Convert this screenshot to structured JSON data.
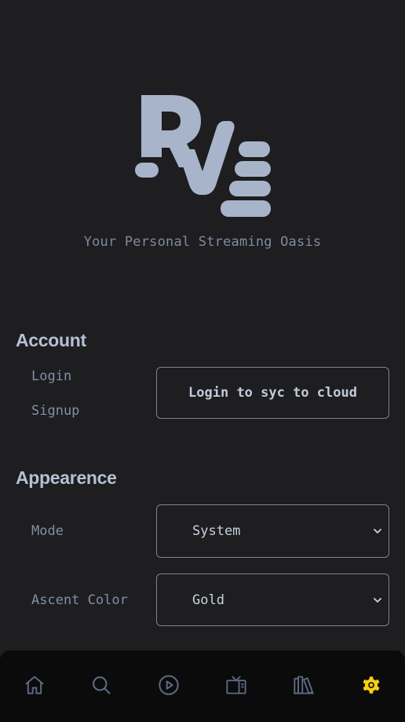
{
  "header": {
    "logo_icon": "rv-logo-icon",
    "tagline": "Your Personal Streaming Oasis"
  },
  "account": {
    "title": "Account",
    "login_label": "Login",
    "signup_label": "Signup",
    "cloud_button_label": "Login to syc to cloud"
  },
  "appearance": {
    "title": "Appearence",
    "mode_label": "Mode",
    "mode_value": "System",
    "color_label": "Ascent Color",
    "color_value": "Gold"
  },
  "bottom_nav": {
    "items": [
      {
        "icon": "home-icon",
        "active": false
      },
      {
        "icon": "search-icon",
        "active": false
      },
      {
        "icon": "play-circle-icon",
        "active": false
      },
      {
        "icon": "tv-icon",
        "active": false
      },
      {
        "icon": "library-icon",
        "active": false
      },
      {
        "icon": "settings-gear-icon",
        "active": true
      }
    ]
  },
  "colors": {
    "background": "#1e1d1f",
    "nav_background": "#0b0b0c",
    "accent": "#f5cf0f",
    "logo": "#a8b4ca",
    "muted_text": "#7f8ba1"
  }
}
